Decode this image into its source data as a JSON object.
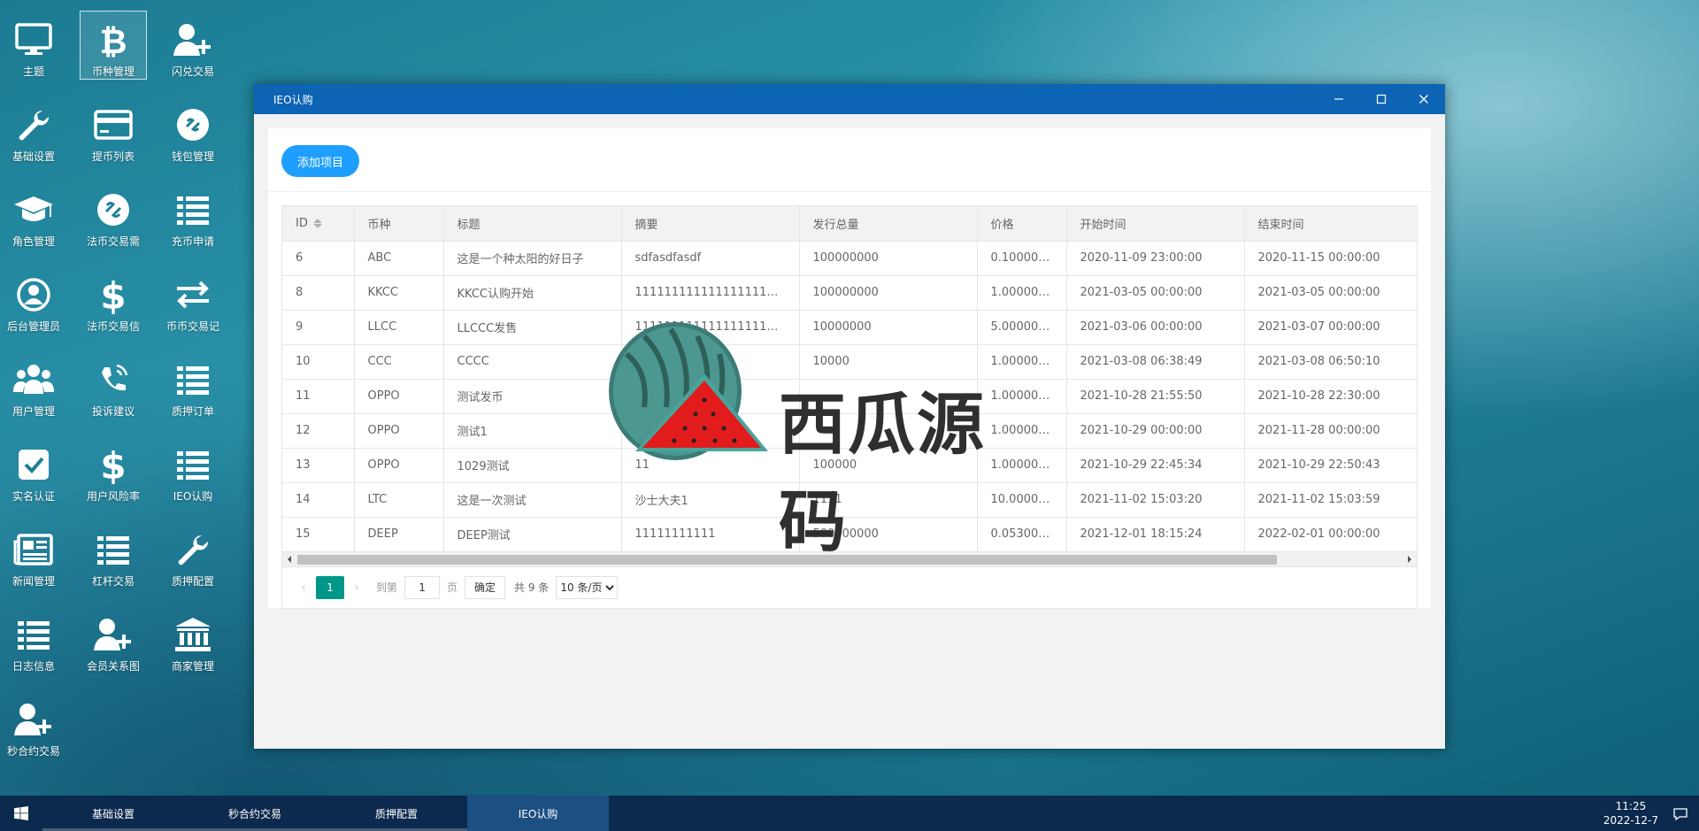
{
  "desktop": {
    "icons": [
      {
        "label": "主题",
        "icon": "monitor-icon"
      },
      {
        "label": "币种管理",
        "icon": "bitcoin-icon"
      },
      {
        "label": "闪兑交易",
        "icon": "user-plus-icon"
      },
      {
        "label": "基础设置",
        "icon": "wrench-icon"
      },
      {
        "label": "提币列表",
        "icon": "credit-card-icon"
      },
      {
        "label": "钱包管理",
        "icon": "wallet-icon"
      },
      {
        "label": "角色管理",
        "icon": "graduation-cap-icon"
      },
      {
        "label": "法币交易需",
        "icon": "exchange-icon"
      },
      {
        "label": "充币申请",
        "icon": "list-icon"
      },
      {
        "label": "后台管理员",
        "icon": "user-circle-icon"
      },
      {
        "label": "法币交易信",
        "icon": "dollar-icon"
      },
      {
        "label": "币币交易记",
        "icon": "swap-arrows-icon"
      },
      {
        "label": "用户管理",
        "icon": "users-icon"
      },
      {
        "label": "投诉建议",
        "icon": "phone-icon"
      },
      {
        "label": "质押订单",
        "icon": "list-icon"
      },
      {
        "label": "实名认证",
        "icon": "check-square-icon"
      },
      {
        "label": "用户风险率",
        "icon": "dollar-icon"
      },
      {
        "label": "IEO认购",
        "icon": "list-icon"
      },
      {
        "label": "新闻管理",
        "icon": "newspaper-icon"
      },
      {
        "label": "杠杆交易",
        "icon": "list-icon"
      },
      {
        "label": "质押配置",
        "icon": "wrench-icon"
      },
      {
        "label": "日志信息",
        "icon": "list-icon"
      },
      {
        "label": "会员关系图",
        "icon": "user-plus-icon"
      },
      {
        "label": "商家管理",
        "icon": "bank-icon"
      },
      {
        "label": "秒合约交易",
        "icon": "user-plus-icon"
      }
    ]
  },
  "window": {
    "title": "IEO认购",
    "add_button": "添加项目",
    "columns": [
      "ID",
      "币种",
      "标题",
      "摘要",
      "发行总量",
      "价格",
      "开始时间",
      "结束时间"
    ],
    "rows": [
      [
        "6",
        "ABC",
        "这是一个种太阳的好日子",
        "sdfasdfasdf",
        "100000000",
        "0.10000000",
        "2020-11-09 23:00:00",
        "2020-11-15 00:00:00"
      ],
      [
        "8",
        "KKCC",
        "KKCC认购开始",
        "1111111111111111111111111111",
        "100000000",
        "1.00000000",
        "2021-03-05 00:00:00",
        "2021-03-05 00:00:00"
      ],
      [
        "9",
        "LLCC",
        "LLCCC发售",
        "1111111111111111111111111111",
        "10000000",
        "5.00000000",
        "2021-03-06 00:00:00",
        "2021-03-07 00:00:00"
      ],
      [
        "10",
        "CCC",
        "CCCC",
        "",
        "10000",
        "1.00000000",
        "2021-03-08 06:38:49",
        "2021-03-08 06:50:10"
      ],
      [
        "11",
        "OPPO",
        "测试发币",
        "",
        "",
        "1.00000000",
        "2021-10-28 21:55:50",
        "2021-10-28 22:30:00"
      ],
      [
        "12",
        "OPPO",
        "测试1",
        "",
        "",
        "1.00000000",
        "2021-10-29 00:00:00",
        "2021-11-28 00:00:00"
      ],
      [
        "13",
        "OPPO",
        "1029测试",
        "11",
        "100000",
        "1.00000000",
        "2021-10-29 22:45:34",
        "2021-10-29 22:50:43"
      ],
      [
        "14",
        "LTC",
        "这是一次测试",
        "沙士大夫1",
        "1111",
        "10.00000000",
        "2021-11-02 15:03:20",
        "2021-11-02 15:03:59"
      ],
      [
        "15",
        "DEEP",
        "DEEP测试",
        "11111111111",
        "500000000",
        "0.05300000",
        "2021-12-01 18:15:24",
        "2022-02-01 00:00:00"
      ]
    ],
    "pager": {
      "current": "1",
      "goto_label": "到第",
      "page_value": "1",
      "page_unit": "页",
      "confirm": "确定",
      "total": "共 9 条",
      "per_page": "10 条/页"
    }
  },
  "watermark": {
    "text": "西瓜源码"
  },
  "taskbar": {
    "tasks": [
      "基础设置",
      "秒合约交易",
      "质押配置",
      "IEO认购"
    ],
    "active_index": 3,
    "time": "11:25",
    "date": "2022-12-7"
  }
}
